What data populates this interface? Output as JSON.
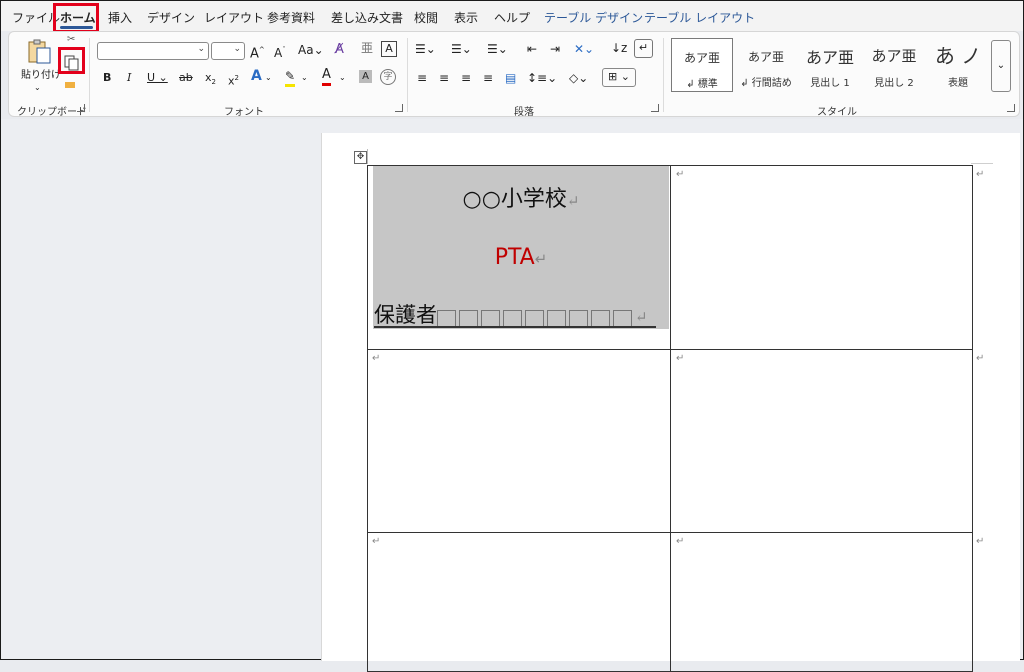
{
  "tabs": [
    {
      "label": "ファイル"
    },
    {
      "label": "ホーム"
    },
    {
      "label": "挿入"
    },
    {
      "label": "デザイン"
    },
    {
      "label": "レイアウト"
    },
    {
      "label": "参考資料"
    },
    {
      "label": "差し込み文書"
    },
    {
      "label": "校閲"
    },
    {
      "label": "表示"
    },
    {
      "label": "ヘルプ"
    },
    {
      "label": "テーブル デザイン"
    },
    {
      "label": "テーブル レイアウト"
    }
  ],
  "ribbon": {
    "clipboard": {
      "paste_label": "貼り付け",
      "group_label": "クリップボード"
    },
    "font": {
      "group_label": "フォント"
    },
    "paragraph": {
      "group_label": "段落"
    },
    "styles": {
      "group_label": "スタイル",
      "items": [
        {
          "sample": "あア亜",
          "name": "標準"
        },
        {
          "sample": "あア亜",
          "name": "行間詰め"
        },
        {
          "sample": "あア亜",
          "name": "見出し 1"
        },
        {
          "sample": "あア亜",
          "name": "見出し 2"
        },
        {
          "sample": "あ ノ",
          "name": "表題"
        }
      ]
    }
  },
  "document": {
    "school": "○○小学校",
    "pta": "PTA",
    "guardian": "保護者",
    "return_mark": "↵"
  },
  "colors": {
    "accent": "#2b5797",
    "highlight_box": "#e3001b",
    "pta_text": "#c00000",
    "cell_shade": "#c6c6c6"
  }
}
